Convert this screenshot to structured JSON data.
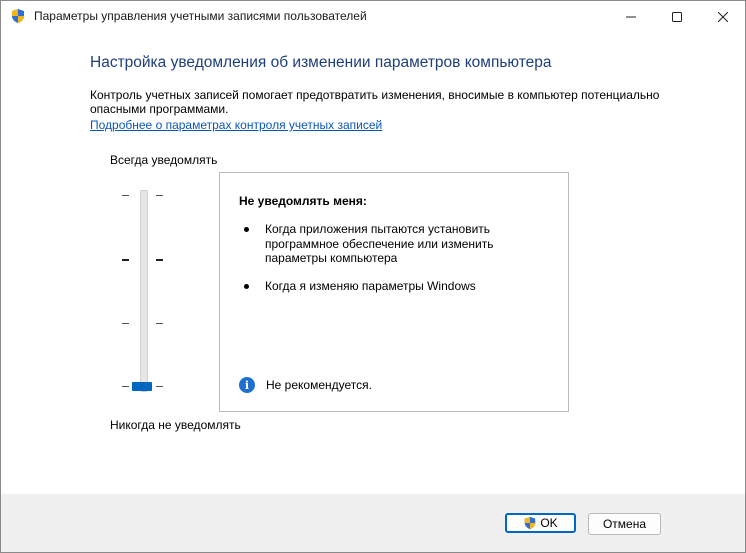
{
  "window": {
    "title": "Параметры управления учетными записями пользователей",
    "icon": "uac-shield-icon"
  },
  "titlebar_buttons": {
    "minimize": "minimize-icon",
    "maximize": "maximize-icon",
    "close": "close-icon"
  },
  "main": {
    "heading": "Настройка уведомления об изменении параметров компьютера",
    "description": "Контроль учетных записей помогает предотвратить изменения, вносимые в компьютер потенциально опасными программами.",
    "link": "Подробнее о параметрах контроля учетных записей"
  },
  "slider": {
    "top_label": "Всегда уведомлять",
    "bottom_label": "Никогда не уведомлять",
    "levels": 4,
    "selected_level": 1
  },
  "info_panel": {
    "title": "Не уведомлять меня:",
    "bullets": [
      "Когда приложения пытаются установить программное обеспечение или изменить параметры компьютера",
      "Когда я изменяю параметры Windows"
    ],
    "note": "Не рекомендуется.",
    "note_icon": "info-icon"
  },
  "footer": {
    "ok_label": "OK",
    "cancel_label": "Отмена"
  },
  "colors": {
    "heading": "#1f3f7a",
    "link": "#0b57b7",
    "accent": "#0067c0"
  }
}
